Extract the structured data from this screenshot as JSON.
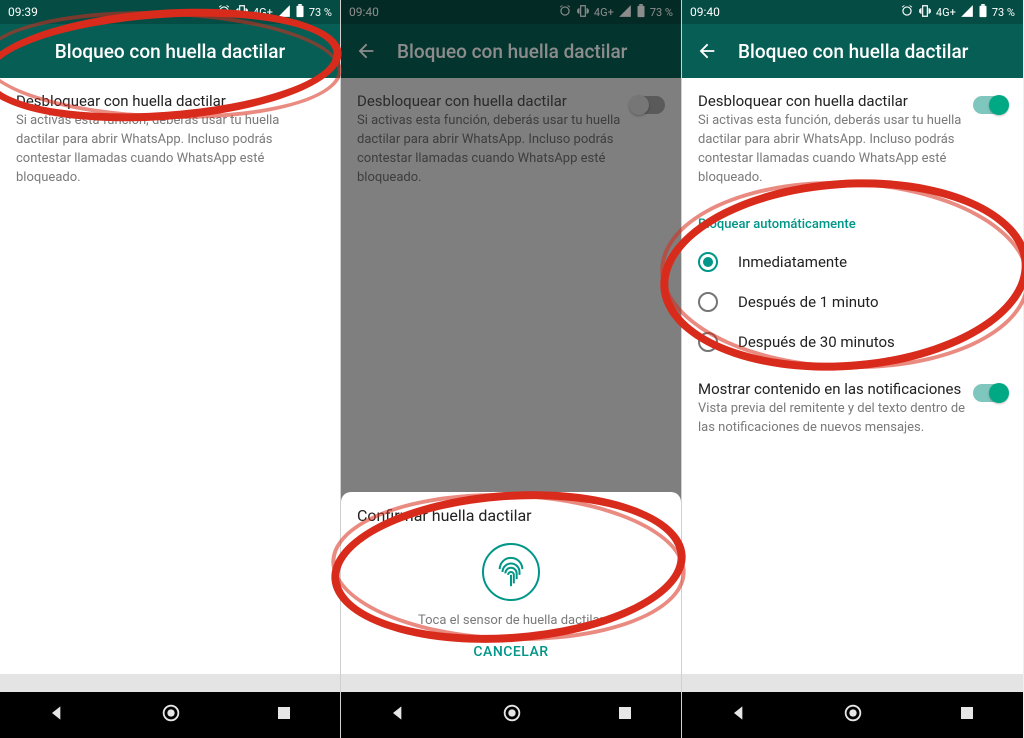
{
  "status": {
    "time1": "09:39",
    "time2": "09:40",
    "time3": "09:40",
    "network": "4G+",
    "battery": "73 %"
  },
  "appbar": {
    "title": "Bloqueo con huella dactilar"
  },
  "unlock": {
    "title": "Desbloquear con huella dactilar",
    "subtitle": "Si activas esta función, deberás usar tu huella dactilar para abrir WhatsApp. Incluso podrás contestar llamadas cuando WhatsApp esté bloqueado."
  },
  "sheet": {
    "title": "Confirmar huella dactilar",
    "hint": "Toca el sensor de huella dactilar",
    "cancel": "CANCELAR"
  },
  "autolock": {
    "section": "Bloquear automáticamente",
    "opt1": "Inmediatamente",
    "opt2": "Después de 1 minuto",
    "opt3": "Después de 30 minutos"
  },
  "notif": {
    "title": "Mostrar contenido en las notificaciones",
    "subtitle": "Vista previa del remitente y del texto dentro de las notificaciones de nuevos mensajes."
  }
}
